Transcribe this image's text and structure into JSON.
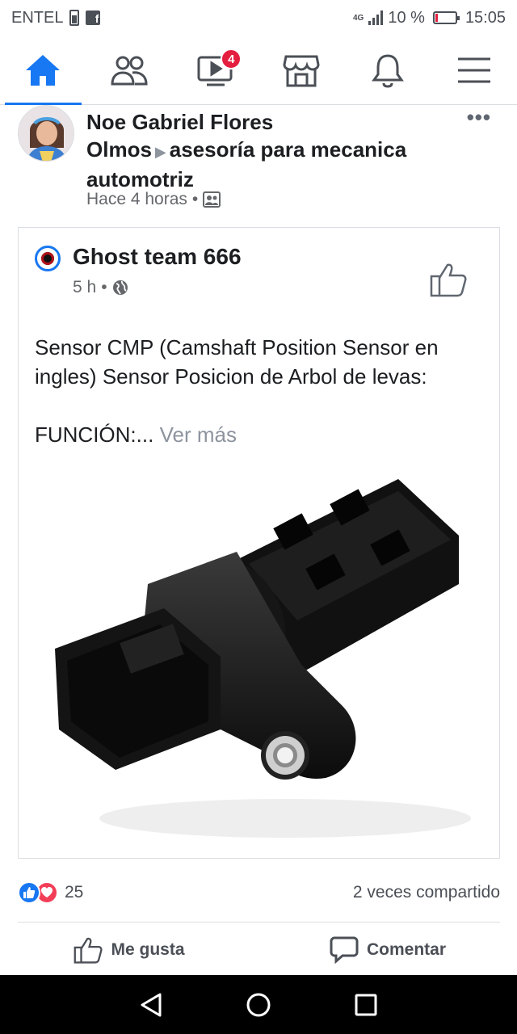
{
  "status_bar": {
    "carrier": "ENTEL",
    "network": "4G",
    "battery_percent": "10 %",
    "battery_level": 0.1,
    "time": "15:05"
  },
  "top_nav": {
    "items": [
      {
        "name": "home-icon",
        "active": true
      },
      {
        "name": "friends-icon",
        "active": false
      },
      {
        "name": "watch-icon",
        "active": false,
        "badge": "4"
      },
      {
        "name": "marketplace-icon",
        "active": false
      },
      {
        "name": "notifications-icon",
        "active": false
      },
      {
        "name": "menu-icon",
        "active": false
      }
    ],
    "accent_color": "#1877f2"
  },
  "post": {
    "author": "Noe Gabriel Flores Olmos",
    "group": "asesoría para mecanica automotriz",
    "time": "Hace 4 horas",
    "more": "•••",
    "shared": {
      "page_name": "Ghost team 666",
      "time": "5 h",
      "text_line1": "Sensor CMP (Camshaft Position Sensor en ingles) Sensor Posicion de Arbol de levas:",
      "text_line2": "FUNCIÓN:...",
      "see_more": "Ver más"
    },
    "reactions": {
      "count": "25",
      "types": [
        "like",
        "love"
      ],
      "shares": "2 veces compartido"
    },
    "actions": {
      "like": "Me gusta",
      "comment": "Comentar"
    }
  },
  "system_nav": [
    "back-icon",
    "home-circle-icon",
    "recents-icon"
  ]
}
